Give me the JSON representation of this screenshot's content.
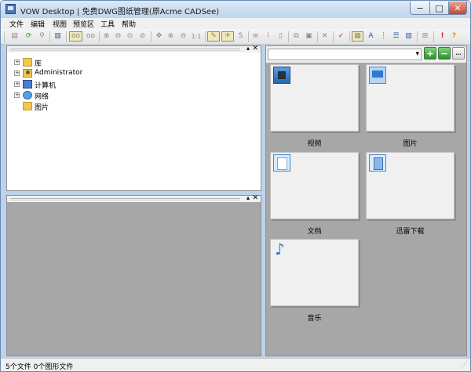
{
  "window": {
    "title": "VOW Desktop | 免费DWG图纸管理(原Acme CADSee)",
    "min_glyph": "−",
    "max_glyph": "□",
    "close_glyph": "✕"
  },
  "menu": {
    "items": [
      {
        "label": "文件"
      },
      {
        "label": "编辑"
      },
      {
        "label": "视图"
      },
      {
        "label": "预览区"
      },
      {
        "label": "工具"
      },
      {
        "label": "帮助"
      }
    ]
  },
  "toolbar": {
    "buttons": [
      {
        "name": "open-folder-icon",
        "glyph": "▤",
        "state": "off"
      },
      {
        "name": "refresh-icon",
        "glyph": "⟳",
        "state": "green"
      },
      {
        "name": "search-file-icon",
        "glyph": "⚲",
        "state": "off"
      },
      {
        "name": "panel-layout-icon",
        "glyph": "▥",
        "state": "on"
      },
      {
        "name": "view-mode-icon",
        "glyph": "oo",
        "state": "pressed"
      },
      {
        "name": "view-mode-alt-icon",
        "glyph": "oo",
        "state": "off"
      },
      {
        "name": "zoom-in-icon",
        "glyph": "⊕",
        "state": "off"
      },
      {
        "name": "zoom-out-icon",
        "glyph": "⊖",
        "state": "off"
      },
      {
        "name": "zoom-window-icon",
        "glyph": "⊙",
        "state": "off"
      },
      {
        "name": "zoom-all-icon",
        "glyph": "⊘",
        "state": "off"
      },
      {
        "name": "pan-icon",
        "glyph": "✥",
        "state": "off"
      },
      {
        "name": "zoom-previous-icon",
        "glyph": "⊕",
        "state": "off"
      },
      {
        "name": "zoom-extents-icon",
        "glyph": "⊖",
        "state": "off"
      },
      {
        "name": "actual-size-icon",
        "glyph": "1:1",
        "state": "off"
      },
      {
        "name": "markup-icon",
        "glyph": "✎",
        "state": "pressed"
      },
      {
        "name": "measure-icon",
        "glyph": "✈",
        "state": "pressed"
      },
      {
        "name": "layer-icon",
        "glyph": "S",
        "state": "off"
      },
      {
        "name": "layers-icon",
        "glyph": "≡",
        "state": "off"
      },
      {
        "name": "info-icon",
        "glyph": "i",
        "state": "off"
      },
      {
        "name": "properties-icon",
        "glyph": "▯",
        "state": "off"
      },
      {
        "name": "copy-icon",
        "glyph": "⧉",
        "state": "off"
      },
      {
        "name": "paste-icon",
        "glyph": "▣",
        "state": "off"
      },
      {
        "name": "delete-icon",
        "glyph": "✕",
        "state": "off"
      },
      {
        "name": "plot-icon",
        "glyph": "✓",
        "state": "red"
      },
      {
        "name": "detail-view-icon",
        "glyph": "▦",
        "state": "pressed"
      },
      {
        "name": "sort-az-icon",
        "glyph": "A",
        "state": "on"
      },
      {
        "name": "tree-view-icon",
        "glyph": "⋮",
        "state": "on"
      },
      {
        "name": "list-view-icon",
        "glyph": "☰",
        "state": "on"
      },
      {
        "name": "thumbnail-view-icon",
        "glyph": "▥",
        "state": "on"
      },
      {
        "name": "options-icon",
        "glyph": "⊞",
        "state": "off"
      },
      {
        "name": "exclamation-icon",
        "glyph": "!",
        "state": "red"
      },
      {
        "name": "help-icon",
        "glyph": "?",
        "state": "orange"
      }
    ]
  },
  "folder_pane": {
    "pin_glyph": "▴",
    "close_glyph": "✕",
    "items": [
      {
        "label": "库",
        "expander": "+"
      },
      {
        "label": "Administrator",
        "expander": "+"
      },
      {
        "label": "计算机",
        "expander": "+"
      },
      {
        "label": "网络",
        "expander": "+"
      },
      {
        "label": "图片",
        "expander": ""
      }
    ]
  },
  "preview_pane": {
    "pin_glyph": "▴",
    "close_glyph": "✕"
  },
  "files_pane": {
    "path_value": "",
    "combo_arrow": "▾",
    "add_glyph": "+",
    "remove_glyph": "−",
    "more_glyph": "…",
    "tiles": [
      {
        "label": "视频"
      },
      {
        "label": "图片"
      },
      {
        "label": "文档"
      },
      {
        "label": "迅雷下载"
      },
      {
        "label": "音乐"
      }
    ]
  },
  "status": {
    "text": "5个文件 0个图形文件",
    "grip_glyph": "⋰"
  }
}
